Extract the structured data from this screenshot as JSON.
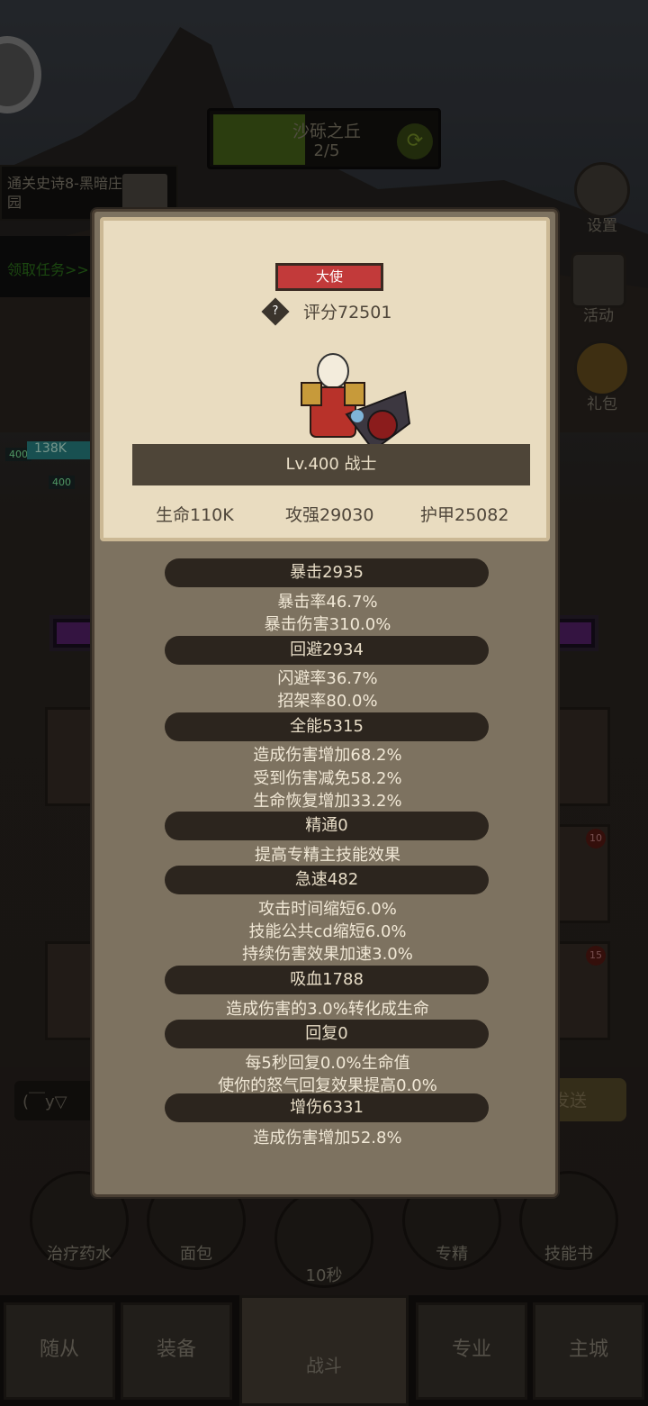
{
  "stage": {
    "name": "沙砾之丘",
    "progress": "2/5"
  },
  "quest": {
    "title": "通关史诗8-黑暗庄园",
    "claim_label": "领取任务>>"
  },
  "side_buttons": {
    "settings": "设置",
    "events": "活动",
    "gift": "礼包"
  },
  "unit": {
    "level_a": "400",
    "hp": "138K",
    "level_b": "400"
  },
  "chat": {
    "input_placeholder": "(￣y▽",
    "send_label": "发送"
  },
  "items": [
    {
      "label": "治疗药水"
    },
    {
      "label": "面包"
    },
    {
      "label": "10秒"
    },
    {
      "label": "专精"
    },
    {
      "label": "技能书"
    }
  ],
  "card_badges": [
    "10",
    "15"
  ],
  "nav": {
    "followers": "随从",
    "equipment": "装备",
    "battle": "战斗",
    "profession": "专业",
    "city": "主城"
  },
  "hero": {
    "rank": "大使",
    "score": "评分72501",
    "level_class": "Lv.400 战士",
    "hp": "生命110K",
    "attack": "攻强29030",
    "armor": "护甲25082"
  },
  "stats": [
    {
      "name": "暴击2935",
      "details": [
        "暴击率46.7%",
        "暴击伤害310.0%"
      ]
    },
    {
      "name": "回避2934",
      "details": [
        "闪避率36.7%",
        "招架率80.0%"
      ]
    },
    {
      "name": "全能5315",
      "details": [
        "造成伤害增加68.2%",
        "受到伤害减免58.2%",
        "生命恢复增加33.2%"
      ]
    },
    {
      "name": "精通0",
      "details": [
        "提高专精主技能效果"
      ]
    },
    {
      "name": "急速482",
      "details": [
        "攻击时间缩短6.0%",
        "技能公共cd缩短6.0%",
        "持续伤害效果加速3.0%"
      ]
    },
    {
      "name": "吸血1788",
      "details": [
        "造成伤害的3.0%转化成生命"
      ]
    },
    {
      "name": "回复0",
      "details": [
        "每5秒回复0.0%生命值",
        "使你的怒气回复效果提高0.0%"
      ]
    },
    {
      "name": "增伤6331",
      "details": [
        "造成伤害增加52.8%"
      ]
    }
  ],
  "colors": {
    "rank_badge": "#c23a3a",
    "stage_progress": "#4b6a1a",
    "popup_bg": "#7d7260",
    "card_bg": "#e9dcc0"
  }
}
